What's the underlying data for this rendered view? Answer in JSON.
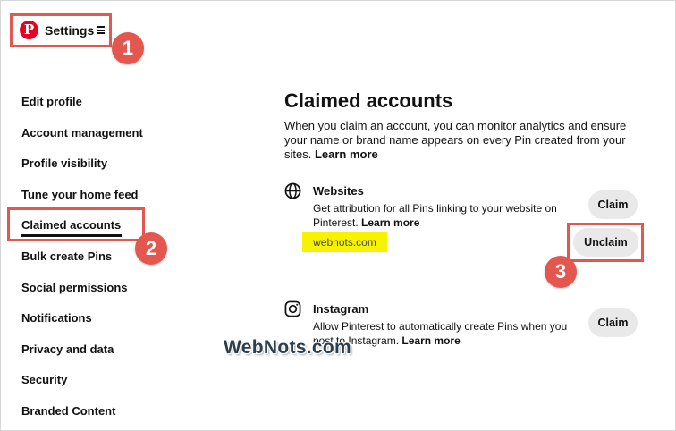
{
  "header": {
    "logo_letter": "P",
    "title": "Settings"
  },
  "callouts": [
    "1",
    "2",
    "3"
  ],
  "sidebar": {
    "items": [
      {
        "label": "Edit profile"
      },
      {
        "label": "Account management"
      },
      {
        "label": "Profile visibility"
      },
      {
        "label": "Tune your home feed"
      },
      {
        "label": "Claimed accounts",
        "active": true
      },
      {
        "label": "Bulk create Pins"
      },
      {
        "label": "Social permissions"
      },
      {
        "label": "Notifications"
      },
      {
        "label": "Privacy and data"
      },
      {
        "label": "Security"
      },
      {
        "label": "Branded Content"
      }
    ]
  },
  "main": {
    "title": "Claimed accounts",
    "description": "When you claim an account, you can monitor analytics and ensure your name or brand name appears on every Pin created from your sites.",
    "description_link": "Learn more",
    "websites": {
      "title": "Websites",
      "description": "Get attribution for all Pins linking to your website on Pinterest.",
      "link": "Learn more",
      "claim_label": "Claim",
      "site": "webnots.com",
      "unclaim_label": "Unclaim"
    },
    "instagram": {
      "title": "Instagram",
      "description": "Allow Pinterest to automatically create Pins when you post to Instagram.",
      "link": "Learn more",
      "claim_label": "Claim"
    }
  },
  "watermark": "WebNots.com",
  "colors": {
    "brand": "#e60023",
    "highlight": "#e4574f",
    "site_highlight": "#f7f300"
  }
}
